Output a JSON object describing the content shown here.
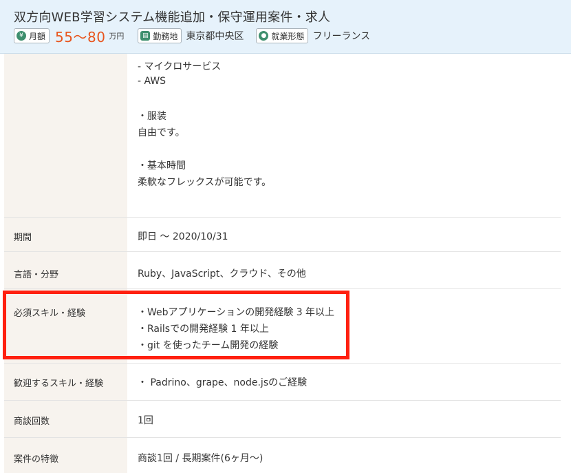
{
  "job": {
    "title": "双方向WEB学習システム機能追加・保守運用案件・求人",
    "salary_label": "月額",
    "salary_value": "55〜80",
    "salary_unit": "万円",
    "location_label": "勤務地",
    "location_value": "東京都中央区",
    "employment_label": "就業形態",
    "employment_value": "フリーランス"
  },
  "icons": {
    "salary": "yen-icon",
    "location": "document-icon",
    "employment": "person-icon"
  },
  "colors": {
    "accent": "#e8541d",
    "highlight": "#ff2010",
    "header_bg": "#e6f2fb",
    "label_bg": "#f7f3ee"
  },
  "details": {
    "description_lines": [
      "- マイクロサービス",
      "- AWS",
      "・服装",
      "自由です。",
      "・基本時間",
      "柔軟なフレックスが可能です。"
    ],
    "rows": [
      {
        "label": "期間",
        "lines": [
          "即日 〜 2020/10/31"
        ]
      },
      {
        "label": "言語・分野",
        "lines": [
          "Ruby、JavaScript、クラウド、その他"
        ]
      },
      {
        "label": "必須スキル・経験",
        "lines": [
          "・Webアプリケーションの開発経験 3 年以上",
          "・Railsでの開発経験 1 年以上",
          "・git を使ったチーム開発の経験"
        ]
      },
      {
        "label": "歓迎するスキル・経験",
        "lines": [
          "・ Padrino、grape、node.jsのご経験"
        ]
      },
      {
        "label": "商談回数",
        "lines": [
          "1回"
        ]
      },
      {
        "label": "案件の特徴",
        "lines": [
          "商談1回 / 長期案件(6ヶ月〜)"
        ]
      }
    ]
  }
}
